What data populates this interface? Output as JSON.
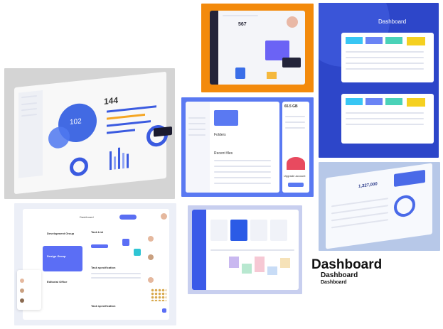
{
  "caption": {
    "title": "Dashboard",
    "subtitle": "Dashboard",
    "small": "Dashboard"
  },
  "tileA": {
    "bubble_value": "102",
    "stat_value": "144"
  },
  "tileB": {
    "stat_value": "567"
  },
  "tileC": {
    "title": "Dashboard"
  },
  "tileD": {
    "storage_value": "65.5 GB",
    "section_folders": "Folders",
    "section_recent": "Recent files",
    "upgrade_label": "Upgrade account"
  },
  "tileE": {
    "stat_value": "1,327,000"
  },
  "tileF": {
    "brand": "Dashboard",
    "group_development": "Development Group",
    "group_design": "Design Group",
    "group_editorial": "Editorial Office",
    "task_list": "Task List",
    "task_specification": "Task specification",
    "task_specification_2": "Task specification"
  },
  "colors": {
    "orange": "#f38a0c",
    "blue_dark": "#2d46c9",
    "blue_mid": "#5a79f2",
    "purple": "#6b63f5"
  }
}
